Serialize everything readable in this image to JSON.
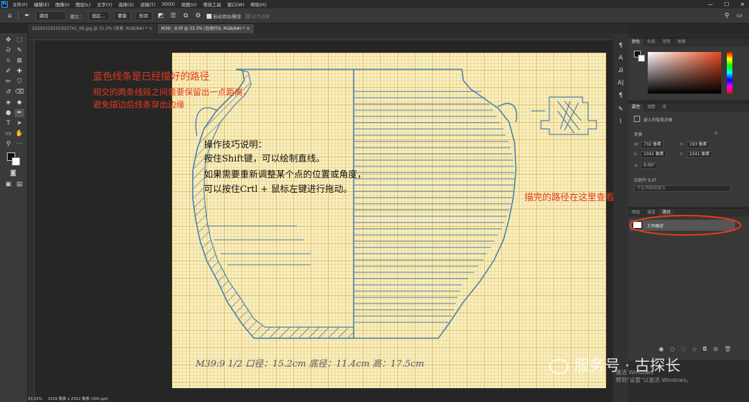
{
  "menubar": {
    "logo": "Ps",
    "items": [
      "文件(F)",
      "编辑(E)",
      "图像(I)",
      "图层(L)",
      "文字(Y)",
      "选择(S)",
      "滤镜(T)",
      "3D(D)",
      "视图(V)",
      "增效工具",
      "窗口(W)",
      "帮助(H)"
    ]
  },
  "window_controls": [
    "—",
    "☐",
    "✕"
  ],
  "options": {
    "mode": "路径",
    "build_label": "建立：",
    "selection_btn": "选区...",
    "mask_btn": "蒙版",
    "shape_btn": "形状",
    "auto_add_delete": "自动添加/删除",
    "align_edges": "对齐边缘"
  },
  "tabs": [
    {
      "label": "20250110102302741_06.jpg @ 31.2% (背景, RGB/8#) *",
      "close": "×",
      "active": false
    },
    {
      "label": "M39：9.tif @ 33.3% (比例尺9, RGB/8#) *",
      "close": "×",
      "active": true
    }
  ],
  "annotations": {
    "blue_lines": "蓝色线条是已经描好的路径",
    "line2": "相交的两条线段之间需要保留出一点距离，",
    "line3": "避免描边后线条穿出边缘",
    "tips_title": "操作技巧说明：",
    "tip1": "按住Shift键，可以绘制直线。",
    "tip2": "如果需要重新调整某个点的位置或角度，",
    "tip3": "可以按住Crtl + 鼠标左键进行拖动。",
    "path_here": "描完的路径在这里查看",
    "handwritten": "M39:9   1/2   口径：15.2cm   底径：11.4cm   高：17.5cm"
  },
  "color_panel": {
    "tabs": [
      "颜色",
      "色板",
      "渐变",
      "图案"
    ],
    "accent": "#e8471d"
  },
  "properties_panel": {
    "tabs": [
      "属性",
      "调整",
      "库"
    ],
    "object_type": "嵌入的智能对象",
    "transform_label": "变换",
    "w_label": "W:",
    "w_value": "732 像素",
    "h_label": "H:",
    "h_value": "193 像素",
    "x_label": "X:",
    "x_value": "1041 像素",
    "y_label": "Y:",
    "y_value": "2341 像素",
    "angle_value": "0.00°",
    "file_name": "比例尺 9.tif",
    "edit_content": "不在用图层复合"
  },
  "paths_panel": {
    "tabs": [
      "图层",
      "通道",
      "路径"
    ],
    "item": "工作路径"
  },
  "watermark": {
    "text": "服务号 · 古探长"
  },
  "windows_activation": {
    "line1": "激活 Windows",
    "line2": "转到\"设置\"以激活 Windows。"
  },
  "status": {
    "zoom": "33.33%",
    "doc": "3329 像素 x 2552 像素 (300 ppi)"
  }
}
